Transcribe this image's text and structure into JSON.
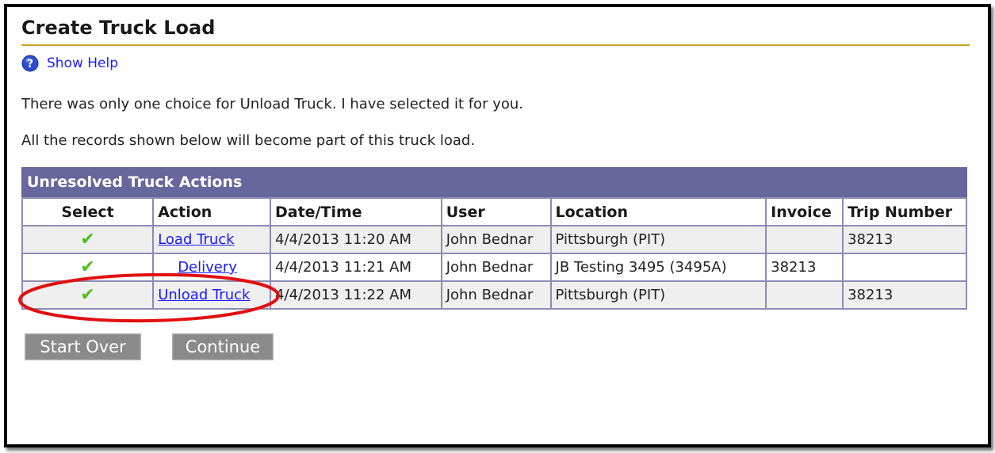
{
  "page": {
    "title": "Create Truck Load",
    "help_label": "Show Help",
    "message_1": "There was only one choice for Unload Truck. I have selected it for you.",
    "message_2": "All the records shown below will become part of this truck load."
  },
  "table": {
    "caption": "Unresolved Truck Actions",
    "columns": [
      "Select",
      "Action",
      "Date/Time",
      "User",
      "Location",
      "Invoice",
      "Trip Number"
    ],
    "rows": [
      {
        "select": "✔",
        "action": "Load Truck",
        "datetime": "4/4/2013 11:20 AM",
        "user": "John Bednar",
        "location": "Pittsburgh (PIT)",
        "invoice": "",
        "trip": "38213"
      },
      {
        "select": "✔",
        "action": "Delivery",
        "datetime": "4/4/2013 11:21 AM",
        "user": "John Bednar",
        "location": "JB Testing 3495 (3495A)",
        "invoice": "38213",
        "trip": ""
      },
      {
        "select": "✔",
        "action": "Unload Truck",
        "datetime": "4/4/2013 11:22 AM",
        "user": "John Bednar",
        "location": "Pittsburgh (PIT)",
        "invoice": "",
        "trip": "38213"
      }
    ]
  },
  "buttons": {
    "start_over": "Start Over",
    "continue": "Continue"
  },
  "colors": {
    "accent_rule": "#c9a227",
    "table_header": "#67679d",
    "link": "#1a1aff",
    "check": "#4fbf1f",
    "annotation": "#e01010"
  },
  "icons": {
    "help": "question-mark-circle-icon",
    "select": "check-mark-icon"
  }
}
